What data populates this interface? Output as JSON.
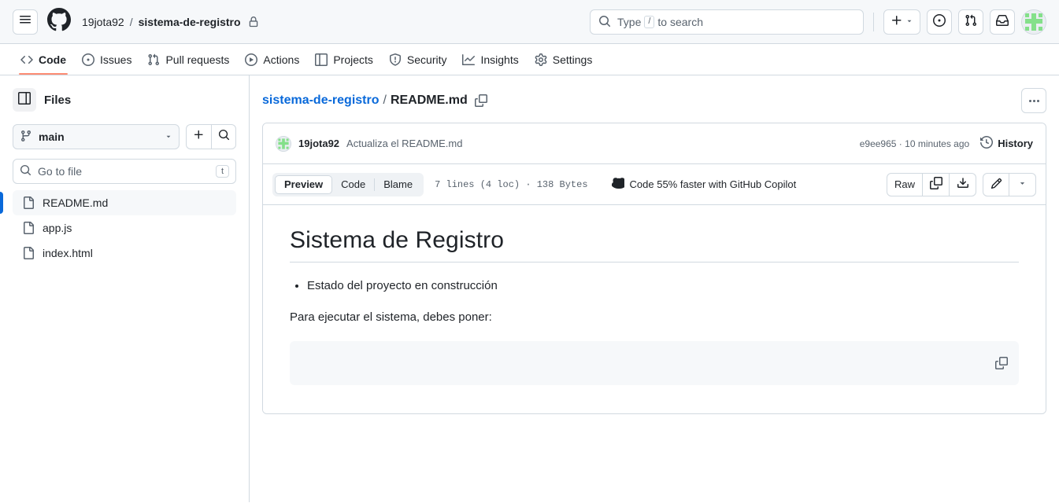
{
  "header": {
    "menu_icon": "hamburger-icon",
    "logo_icon": "github-logo-icon",
    "owner": "19jota92",
    "separator": "/",
    "repo": "sistema-de-registro",
    "visibility_icon": "lock-icon",
    "search": {
      "placeholder_prefix": "Type",
      "key_hint": "/",
      "placeholder_suffix": "to search",
      "icon": "search-icon"
    },
    "actions": [
      {
        "name": "create-new-button",
        "icon": "plus-icon",
        "caret": true
      },
      {
        "name": "issues-button",
        "icon": "issue-opened-icon"
      },
      {
        "name": "pull-requests-button",
        "icon": "git-pull-request-icon"
      },
      {
        "name": "notifications-button",
        "icon": "inbox-icon"
      }
    ],
    "avatar": {
      "name": "user-avatar",
      "color": "#84e08a"
    }
  },
  "repo_nav": {
    "items": [
      {
        "label": "Code",
        "icon": "code-icon",
        "active": true
      },
      {
        "label": "Issues",
        "icon": "issue-opened-icon",
        "active": false
      },
      {
        "label": "Pull requests",
        "icon": "git-pull-request-icon",
        "active": false
      },
      {
        "label": "Actions",
        "icon": "play-icon",
        "active": false
      },
      {
        "label": "Projects",
        "icon": "table-icon",
        "active": false
      },
      {
        "label": "Security",
        "icon": "shield-icon",
        "active": false
      },
      {
        "label": "Insights",
        "icon": "graph-icon",
        "active": false
      },
      {
        "label": "Settings",
        "icon": "gear-icon",
        "active": false
      }
    ],
    "active_underline_color": "#fd8c73"
  },
  "sidebar": {
    "title": "Files",
    "panel_toggle_icon": "sidebar-collapse-icon",
    "branch": {
      "name": "main",
      "icon": "git-branch-icon",
      "caret_icon": "chevron-down-icon"
    },
    "add_button_icon": "plus-icon",
    "search_button_icon": "search-icon",
    "go_to_file": {
      "placeholder": "Go to file",
      "icon": "search-icon",
      "key_hint": "t"
    },
    "files": [
      {
        "name": "README.md",
        "icon": "file-icon",
        "selected": true
      },
      {
        "name": "app.js",
        "icon": "file-icon",
        "selected": false
      },
      {
        "name": "index.html",
        "icon": "file-icon",
        "selected": false
      }
    ],
    "selected_indicator_color": "#0969da"
  },
  "main": {
    "breadcrumb": {
      "repo": "sistema-de-registro",
      "separator": "/",
      "file": "README.md",
      "copy_icon": "copy-icon"
    },
    "kebab_menu": "more-options-button",
    "commit": {
      "author": "19jota92",
      "message": "Actualiza el README.md",
      "hash": "e9ee965",
      "meta_separator": "·",
      "time": "10 minutes ago",
      "history_label": "History",
      "history_icon": "history-icon"
    },
    "toolbar": {
      "tabs": [
        {
          "label": "Preview",
          "active": true
        },
        {
          "label": "Code",
          "active": false
        },
        {
          "label": "Blame",
          "active": false
        }
      ],
      "file_meta": "7 lines (4 loc) · 138 Bytes",
      "copilot_hint": "Code 55% faster with GitHub Copilot",
      "copilot_icon": "copilot-icon",
      "raw_label": "Raw",
      "copy_icon": "copy-icon",
      "download_icon": "download-icon",
      "edit_icon": "pencil-icon",
      "caret_icon": "chevron-down-icon"
    },
    "readme": {
      "heading": "Sistema de Registro",
      "bullets": [
        "Estado del proyecto en construcción"
      ],
      "paragraph": "Para ejecutar el sistema, debes poner:",
      "code_block_content": "",
      "code_copy_icon": "copy-icon"
    }
  }
}
